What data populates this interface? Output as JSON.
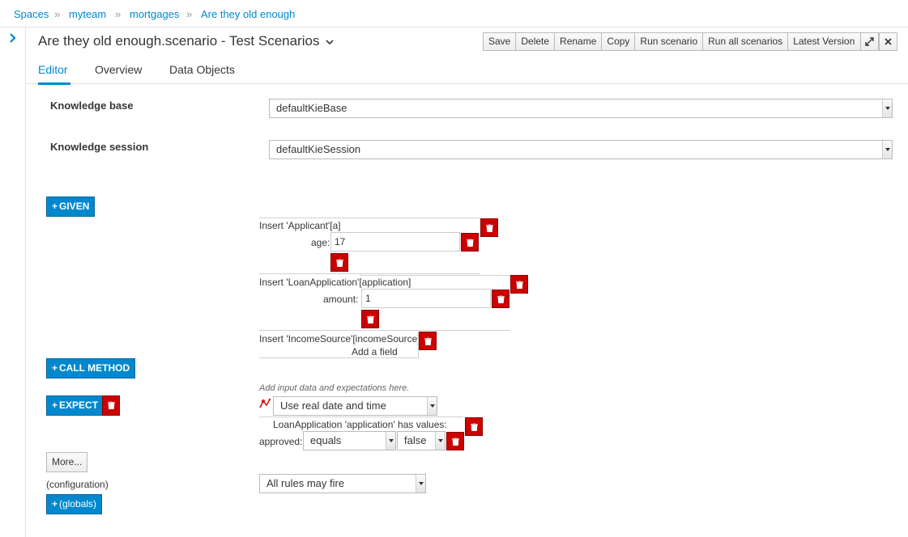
{
  "breadcrumb": {
    "items": [
      "Spaces",
      "myteam",
      "mortgages",
      "Are they old enough"
    ],
    "separator": "»"
  },
  "title": {
    "text": "Are they old enough.scenario - Test Scenarios",
    "caret": "⌄"
  },
  "toolbar": {
    "save": "Save",
    "delete": "Delete",
    "rename": "Rename",
    "copy": "Copy",
    "run_scenario": "Run scenario",
    "run_all": "Run all scenarios",
    "latest_version": "Latest Version",
    "expand_icon": "expand-icon",
    "close_icon": "close-icon"
  },
  "tabs": [
    "Editor",
    "Overview",
    "Data Objects"
  ],
  "knowledge": {
    "base_label": "Knowledge base",
    "base_value": "defaultKieBase",
    "session_label": "Knowledge session",
    "session_value": "defaultKieSession"
  },
  "given": {
    "button": "GIVEN",
    "facts": [
      {
        "header": "Insert 'Applicant'",
        "var": "[a]",
        "field_label": "age:",
        "field_value": "17"
      },
      {
        "header": "Insert 'LoanApplication'",
        "var": "[application]",
        "field_label": "amount:",
        "field_value": "1"
      },
      {
        "header": "Insert 'IncomeSource'",
        "var": "[incomeSource]",
        "add_field": "Add a field"
      }
    ]
  },
  "call_method": {
    "button": "CALL METHOD"
  },
  "expect": {
    "button": "EXPECT",
    "hint": "Add input data and expectations here.",
    "date_mode": "Use real date and time",
    "fact_header": "LoanApplication 'application' has values:",
    "field_label": "approved:",
    "operator": "equals",
    "value": "false"
  },
  "more": {
    "button": "More...",
    "config_label": "(configuration)",
    "rules_select": "All rules may fire",
    "globals_button": "(globals)"
  },
  "colors": {
    "accent": "#0088ce",
    "danger": "#cc0000"
  }
}
